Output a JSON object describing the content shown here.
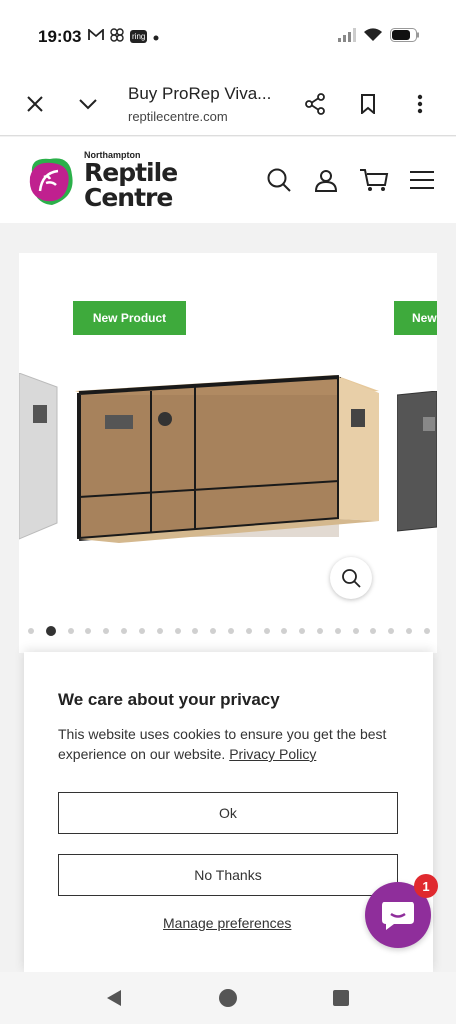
{
  "status_bar": {
    "time": "19:03",
    "notification_icons": [
      "gmail-icon",
      "pinwheel-icon",
      "ring-icon",
      "dot-icon"
    ],
    "ring_label": "ring",
    "system_icons": [
      "signal-icon",
      "wifi-icon",
      "battery-icon"
    ]
  },
  "browser": {
    "page_title": "Buy ProRep Viva...",
    "url": "reptilecentre.com"
  },
  "site": {
    "logo_small": "Northampton",
    "logo_line1": "Reptile",
    "logo_line2": "Centre"
  },
  "product": {
    "badge_label": "New Product",
    "badge_label_partial": "New",
    "carousel_dot_count": 23,
    "active_dot_index": 1
  },
  "privacy": {
    "heading": "We care about your privacy",
    "message": "This website uses cookies to ensure you get the best experience on our website.",
    "policy_link": "Privacy Policy",
    "ok_label": "Ok",
    "no_thanks_label": "No Thanks",
    "manage_label": "Manage preferences"
  },
  "chat": {
    "badge_count": "1"
  },
  "colors": {
    "accent_green": "#3eaa3c",
    "chat_purple": "#8f2e9b",
    "badge_red": "#e0292f"
  }
}
